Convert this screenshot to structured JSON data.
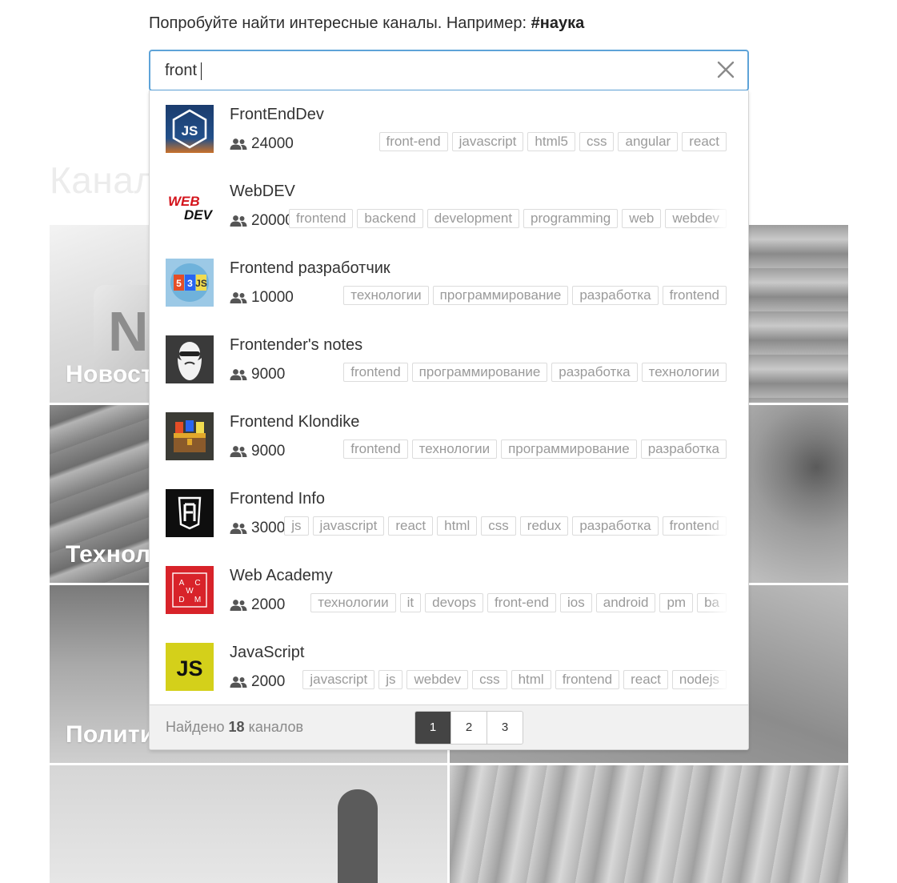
{
  "hint": {
    "text": "Попробуйте найти интересные каналы. Например:",
    "example": "#наука"
  },
  "background": {
    "heading": "Канал",
    "tiles": [
      {
        "label": "Новост"
      },
      {
        "label": "Технол"
      },
      {
        "label": "Полити"
      }
    ]
  },
  "search": {
    "query": "front",
    "clear_icon": "close-x-icon"
  },
  "results": [
    {
      "name": "FrontEndDev",
      "members": "24000",
      "avatar": "node-js-logo",
      "tags": [
        "front-end",
        "javascript",
        "html5",
        "css",
        "angular",
        "react"
      ]
    },
    {
      "name": "WebDEV",
      "members": "20000",
      "avatar": "webdev-logo",
      "tags": [
        "frontend",
        "backend",
        "development",
        "programming",
        "web",
        "webdev"
      ]
    },
    {
      "name": "Frontend разработчик",
      "members": "10000",
      "avatar": "html-css-js-badge",
      "tags": [
        "технологии",
        "программирование",
        "разработка",
        "frontend"
      ]
    },
    {
      "name": "Frontender's notes",
      "members": "9000",
      "avatar": "bearded-man-logo",
      "tags": [
        "frontend",
        "программирование",
        "разработка",
        "технологии"
      ]
    },
    {
      "name": "Frontend Klondike",
      "members": "9000",
      "avatar": "treasure-chest-logo",
      "tags": [
        "frontend",
        "технологии",
        "программирование",
        "разработка"
      ]
    },
    {
      "name": "Frontend Info",
      "members": "3000",
      "avatar": "f-shield-logo",
      "tags": [
        "js",
        "javascript",
        "react",
        "html",
        "css",
        "redux",
        "разработка",
        "frontend"
      ]
    },
    {
      "name": "Web Academy",
      "members": "2000",
      "avatar": "awdm-logo",
      "tags": [
        "технологии",
        "it",
        "devops",
        "front-end",
        "ios",
        "android",
        "pm",
        "ba"
      ]
    },
    {
      "name": "JavaScript",
      "members": "2000",
      "avatar": "js-logo",
      "tags": [
        "javascript",
        "js",
        "webdev",
        "css",
        "html",
        "frontend",
        "react",
        "nodejs"
      ]
    }
  ],
  "footer": {
    "found_prefix": "Найдено",
    "found_count": "18",
    "found_suffix": "каналов",
    "pages": [
      "1",
      "2",
      "3"
    ],
    "current_page": "1"
  },
  "colors": {
    "focus_border": "#5ea3d8",
    "active_page": "#444444",
    "tag_text": "#9a9a9a"
  }
}
